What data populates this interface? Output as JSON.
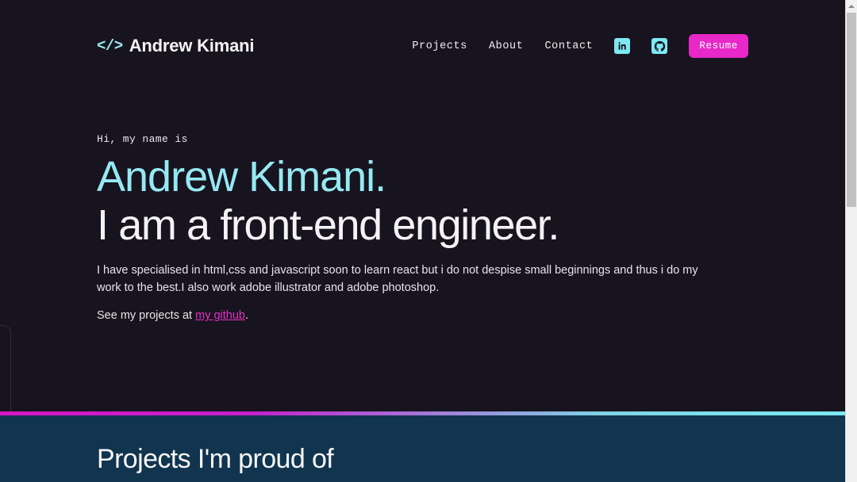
{
  "brand": {
    "icon": "code-brackets-icon",
    "icon_glyph": "</>",
    "name": "Andrew Kimani"
  },
  "nav": {
    "links": [
      {
        "label": "Projects",
        "name": "nav-link-projects"
      },
      {
        "label": "About",
        "name": "nav-link-about"
      },
      {
        "label": "Contact",
        "name": "nav-link-contact"
      }
    ],
    "socials": [
      {
        "name": "linkedin-icon",
        "label": "in"
      },
      {
        "name": "github-icon",
        "label": "github"
      }
    ],
    "resume_label": "Resume"
  },
  "hero": {
    "greeting": "Hi, my name is",
    "name": "Andrew Kimani.",
    "title": "I am a front-end engineer.",
    "paragraph": "I have specialised in html,css and javascript soon to learn react but i do not despise small beginnings and thus i do my work to the best.I also work adobe illustrator and adobe photoshop.",
    "link_prefix": "See my projects at ",
    "link_label": "my github",
    "link_suffix": "."
  },
  "projects": {
    "title": "Projects I'm proud of"
  },
  "colors": {
    "background": "#17141f",
    "accent_cyan": "#7ee8f3",
    "accent_magenta": "#e828c8",
    "heading_cyan": "#96e9f2",
    "projects_background": "#11344f",
    "text_light": "#e6e5ea"
  },
  "scrollbar": {
    "name": "vertical-scrollbar"
  }
}
